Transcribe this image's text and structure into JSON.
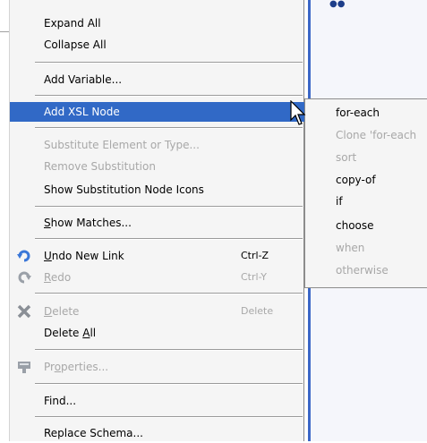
{
  "menu": {
    "items": [
      {
        "label": "Expand All"
      },
      {
        "label": "Collapse All"
      },
      {
        "label": "Add Variable..."
      },
      {
        "label": "Add XSL Node"
      },
      {
        "label": "Substitute Element or Type..."
      },
      {
        "label": "Remove Substitution"
      },
      {
        "label": "Show Substitution Node Icons"
      },
      {
        "label_pre": "",
        "label_u": "S",
        "label_post": "how Matches..."
      },
      {
        "label_pre": "",
        "label_u": "U",
        "label_post": "ndo New Link",
        "shortcut": "Ctrl-Z",
        "icon": "undo-icon"
      },
      {
        "label_pre": "",
        "label_u": "R",
        "label_post": "edo",
        "shortcut": "Ctrl-Y",
        "icon": "redo-icon"
      },
      {
        "label_pre": "",
        "label_u": "D",
        "label_post": "elete",
        "shortcut": "Delete",
        "icon": "delete-icon"
      },
      {
        "label_pre": "Delete ",
        "label_u": "A",
        "label_post": "ll"
      },
      {
        "label_pre": "Pr",
        "label_u": "o",
        "label_post": "perties...",
        "icon": "properties-icon"
      },
      {
        "label": "Find..."
      },
      {
        "label": "Replace Schema..."
      }
    ]
  },
  "submenu": {
    "items": [
      {
        "label": "for-each"
      },
      {
        "label": "Clone 'for-each"
      },
      {
        "label": "sort"
      },
      {
        "label": "copy-of"
      },
      {
        "label": "if"
      },
      {
        "label": "choose"
      },
      {
        "label": "when"
      },
      {
        "label": "otherwise"
      }
    ]
  },
  "colors": {
    "highlight": "#3169c6",
    "disabled_text": "#a8a8a8",
    "menu_bg": "#f5f5f5"
  }
}
